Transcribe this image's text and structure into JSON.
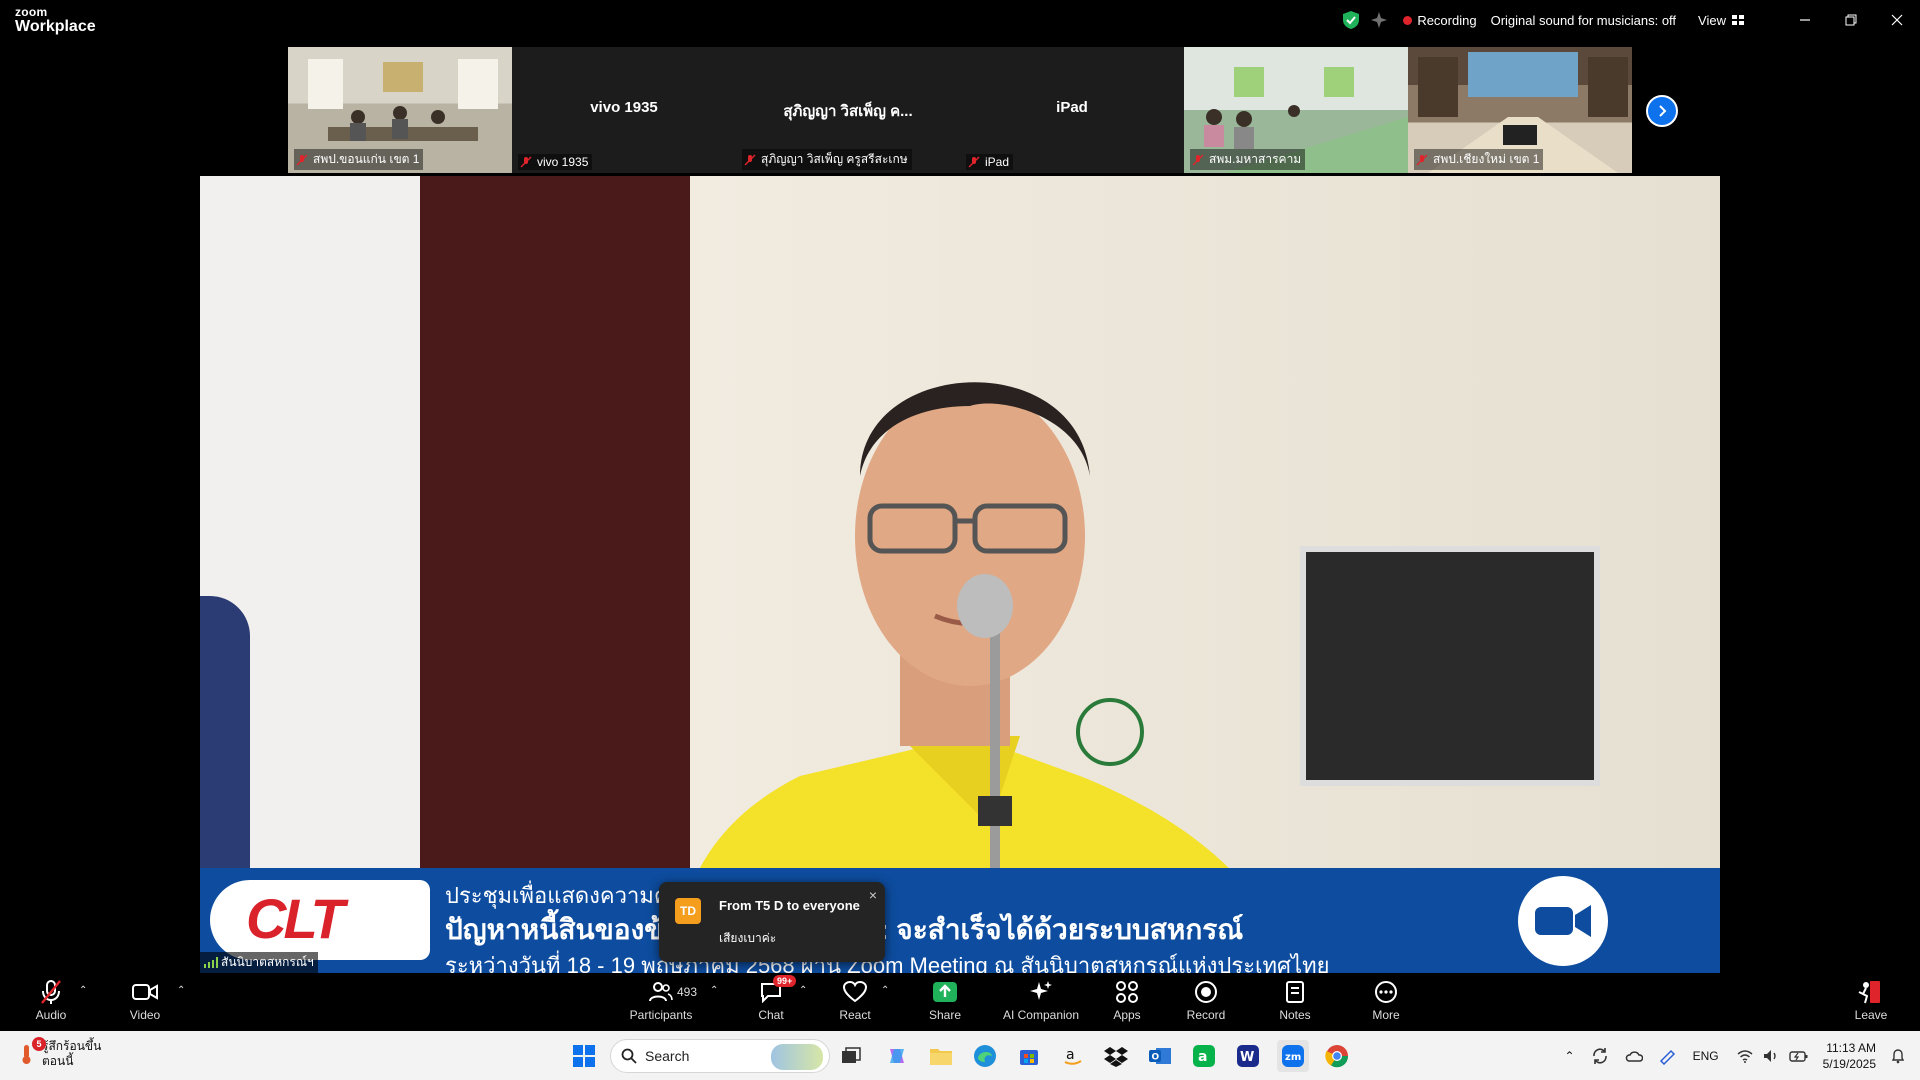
{
  "app": {
    "logo_top": "zoom",
    "logo_bottom": "Workplace"
  },
  "titlebar": {
    "recording_label": "Recording",
    "original_sound": "Original sound for musicians: off",
    "view_label": "View"
  },
  "gallery": {
    "tiles": [
      {
        "big_name": "",
        "label": "สพป.ขอนแก่น เขต 1"
      },
      {
        "big_name": "vivo 1935",
        "label": "vivo 1935"
      },
      {
        "big_name": "สุภิญญา วิสเพ็ญ ค...",
        "label": "สุภิญญา วิสเพ็ญ ครูสรีสะเกษ"
      },
      {
        "big_name": "iPad",
        "label": "iPad"
      },
      {
        "big_name": "",
        "label": "สพม.มหาสารคาม"
      },
      {
        "big_name": "",
        "label": "สพป.เชียงใหม่ เขต 1"
      }
    ]
  },
  "main_video": {
    "speaker_label": "สันนิบาตสหกรณ์ฯ",
    "banner_logo": "CLT",
    "banner_line1": "ประชุมเพื่อแสดงความค",
    "banner_line2": "ปัญหาหนี้สินของข้                  ฐบาลอยากแก้ไข : จะสำเร็จได้ด้วยระบบสหกรณ์",
    "banner_line3": "ระหว่างวันที่  18 - 19 พฤษภาคม 2568 ผ่าน Zoom Meeting ณ สันนิบาตสหกรณ์แห่งประเทศไทย"
  },
  "chat_popup": {
    "avatar": "TD",
    "from": "From T5 D to everyone",
    "message": "เสียงเบาค่ะ",
    "close": "×"
  },
  "toolbar": {
    "audio": "Audio",
    "video": "Video",
    "participants": "Participants",
    "participants_count": "493",
    "chat": "Chat",
    "chat_badge": "99+",
    "react": "React",
    "share": "Share",
    "ai_companion": "AI Companion",
    "apps": "Apps",
    "record": "Record",
    "notes": "Notes",
    "more": "More",
    "leave": "Leave"
  },
  "taskbar": {
    "weather_badge": "5",
    "weather_line1": "รู้สึกร้อนขึ้น",
    "weather_line2": "ตอนนี้",
    "search_placeholder": "Search",
    "lang": "ENG",
    "time": "11:13 AM",
    "date": "5/19/2025"
  },
  "colors": {
    "accent_blue": "#0e72ed",
    "recording_red": "#e0242b",
    "share_green": "#1fb25a",
    "banner_blue": "#0d4c9e"
  }
}
